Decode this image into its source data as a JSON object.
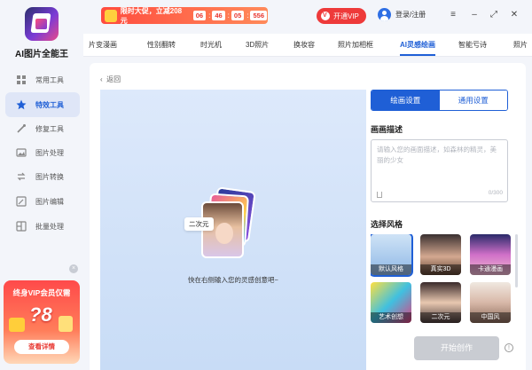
{
  "app": {
    "name": "AI图片全能王"
  },
  "sidebar": {
    "items": [
      {
        "label": "常用工具",
        "icon": "grid-icon"
      },
      {
        "label": "特效工具",
        "icon": "star-icon"
      },
      {
        "label": "修复工具",
        "icon": "wand-icon"
      },
      {
        "label": "图片处理",
        "icon": "image-icon"
      },
      {
        "label": "图片转换",
        "icon": "convert-icon"
      },
      {
        "label": "图片编辑",
        "icon": "edit-icon"
      },
      {
        "label": "批量处理",
        "icon": "batch-icon"
      }
    ],
    "promo": {
      "title": "终身VIP会员仅需",
      "price": "?8",
      "button": "查看详情"
    }
  },
  "topbar": {
    "banner_text": "限时大促，立减208元",
    "countdown": [
      "06",
      "46",
      "05",
      "556"
    ],
    "vip_button": "开通VIP",
    "login": "登录/注册"
  },
  "tabs": [
    "片变漫画",
    "性别翻转",
    "时光机",
    "3D照片",
    "换妆容",
    "照片加相框",
    "AI灵感绘画",
    "智能亏诗",
    "照片"
  ],
  "main": {
    "back": "返回",
    "canvas": {
      "tag": "二次元",
      "hint": "快在右侧输入您的灵感创意吧~"
    },
    "settings": {
      "tab_active": "绘画设置",
      "tab_other": "通用设置",
      "desc_title": "画画描述",
      "desc_placeholder": "请输入您的画面描述，如森林的精灵，美丽的少女",
      "counter": "0/300",
      "style_title": "选择风格",
      "styles": [
        "默认风格",
        "真实3D",
        "卡通漫画",
        "艺术创想",
        "二次元",
        "中国风"
      ]
    },
    "start_button": "开始创作"
  }
}
